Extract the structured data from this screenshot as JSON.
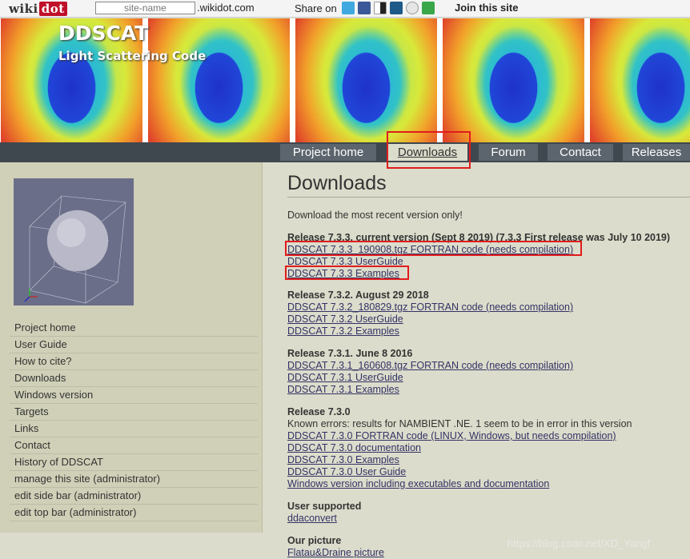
{
  "topbar": {
    "logo_text": "wiki",
    "logo_dot": "dot",
    "site_input_placeholder": "site-name",
    "domain_suffix": ".wikidot.com",
    "share_label": "Share on",
    "share_icons": [
      "twitter-icon",
      "facebook-icon",
      "delicious-icon",
      "digg-icon",
      "reddit-icon",
      "stumbleupon-icon"
    ],
    "join_label": "Join this site"
  },
  "header": {
    "title": "DDSCAT",
    "subtitle": "Light Scattering Code"
  },
  "nav": {
    "tabs": [
      {
        "label": "Project home"
      },
      {
        "label": "Downloads",
        "active": true
      },
      {
        "label": "Forum"
      },
      {
        "label": "Contact"
      },
      {
        "label": "Releases"
      }
    ]
  },
  "sidebar": {
    "items": [
      "Project home",
      "User Guide",
      "How to cite?",
      "Downloads",
      "Windows version",
      "Targets",
      "Links",
      "Contact",
      "History of DDSCAT",
      "manage this site (administrator)",
      "edit side bar (administrator)",
      "edit top bar (administrator)"
    ]
  },
  "main": {
    "title": "Downloads",
    "intro": "Download the most recent version only!",
    "releases": [
      {
        "heading": "Release 7.3.3, current version (Sept 8 2019) (7.3.3 First release was July 10 2019)",
        "links": [
          "DDSCAT 7.3.3_190908.tgz FORTRAN code (needs compilation)",
          "DDSCAT 7.3.3 UserGuide",
          "DDSCAT 7.3.3 Examples"
        ]
      },
      {
        "heading": "Release 7.3.2. August 29 2018",
        "links": [
          "DDSCAT 7.3.2_180829.tgz FORTRAN code (needs compilation)",
          "DDSCAT 7.3.2 UserGuide",
          "DDSCAT 7.3.2 Examples"
        ]
      },
      {
        "heading": "Release 7.3.1. June 8 2016",
        "links": [
          "DDSCAT 7.3.1_160608.tgz FORTRAN code (needs compilation)",
          "DDSCAT 7.3.1 UserGuide",
          "DDSCAT 7.3.1 Examples"
        ]
      },
      {
        "heading": "Release 7.3.0",
        "note": "Known errors: results for NAMBIENT .NE. 1 seem to be in error in this version",
        "links": [
          "DDSCAT 7.3.0 FORTRAN code (LINUX, Windows, but needs compilation)",
          "DDSCAT 7.3.0 documentation",
          "DDSCAT 7.3.0 Examples",
          "DDSCAT 7.3.0 User Guide",
          "Windows version including executables and documentation"
        ]
      },
      {
        "heading": "User supported",
        "links": [
          "ddaconvert"
        ]
      },
      {
        "heading": "Our picture",
        "links": [
          "Flatau&Draine picture"
        ]
      }
    ]
  },
  "watermark": "https://blog.csdn.net/XD_Yangf",
  "colors": {
    "highlight_box": "#e01c1c",
    "nav_bar": "#3f474f",
    "sidebar_bg": "#d0d0b8"
  }
}
